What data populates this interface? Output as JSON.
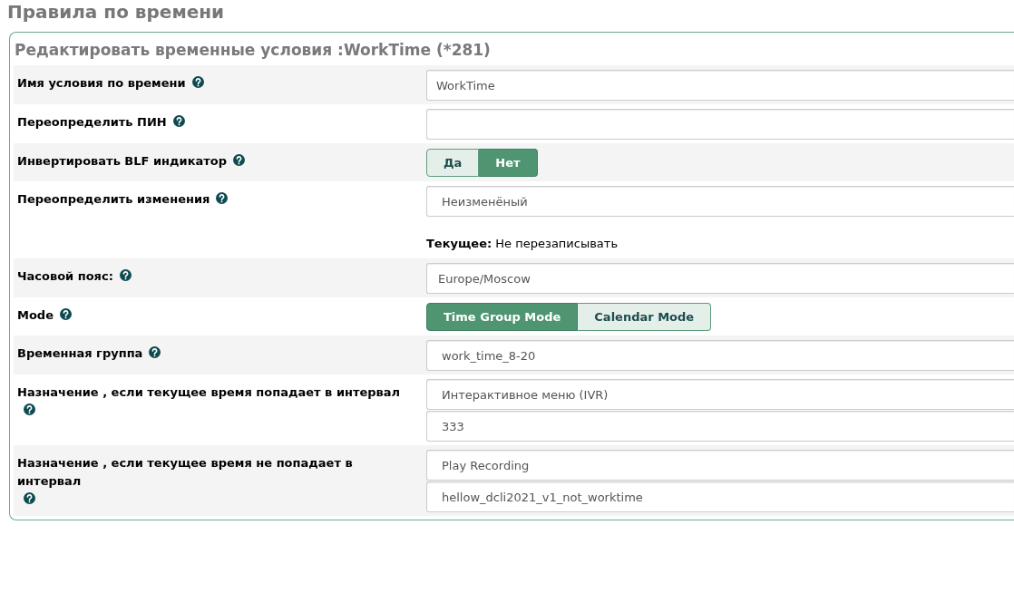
{
  "page_title": "Правила по времени",
  "form": {
    "title": "Редактировать временные условия :WorkTime (*281)",
    "rows": [
      {
        "kind": "fields",
        "label": "Имя условия по времени",
        "fields": [
          {
            "kind": "input",
            "value": "WorkTime"
          }
        ]
      },
      {
        "kind": "fields",
        "label": "Переопределить ПИН",
        "fields": [
          {
            "kind": "input"
          }
        ]
      },
      {
        "kind": "toggle",
        "label": "Инвертировать BLF индикатор",
        "options": [
          {
            "label": "Да",
            "selected": false
          },
          {
            "label": "Нет",
            "selected": true
          }
        ]
      },
      {
        "kind": "fields",
        "label": "Переопределить изменения",
        "fields": [
          {
            "kind": "select",
            "value": "Неизменёный"
          }
        ],
        "note": "**Текущее:** Не перезаписывать"
      },
      {
        "kind": "fields",
        "label": "Часовой пояс:",
        "fields": [
          {
            "kind": "combo",
            "value": "Europe/Moscow"
          }
        ]
      },
      {
        "kind": "toggle",
        "label": "Mode",
        "options": [
          {
            "label": "Time Group Mode",
            "selected": true
          },
          {
            "label": "Calendar Mode",
            "selected": false
          }
        ]
      },
      {
        "kind": "fields",
        "label": "Временная группа",
        "fields": [
          {
            "kind": "select",
            "value": "work_time_8-20"
          }
        ]
      },
      {
        "kind": "fields",
        "label": "Назначение , если текущее время попадает в интервал",
        "fields": [
          {
            "kind": "select",
            "value": "Интерактивное меню (IVR)"
          },
          {
            "kind": "select",
            "value": "333"
          }
        ]
      },
      {
        "kind": "fields",
        "label": "Назначение , если текущее время не попадает в интервал",
        "fields": [
          {
            "kind": "select",
            "value": "Play Recording"
          },
          {
            "kind": "select",
            "value": "hellow_dcli2021_v1_not_worktime"
          }
        ]
      }
    ]
  }
}
